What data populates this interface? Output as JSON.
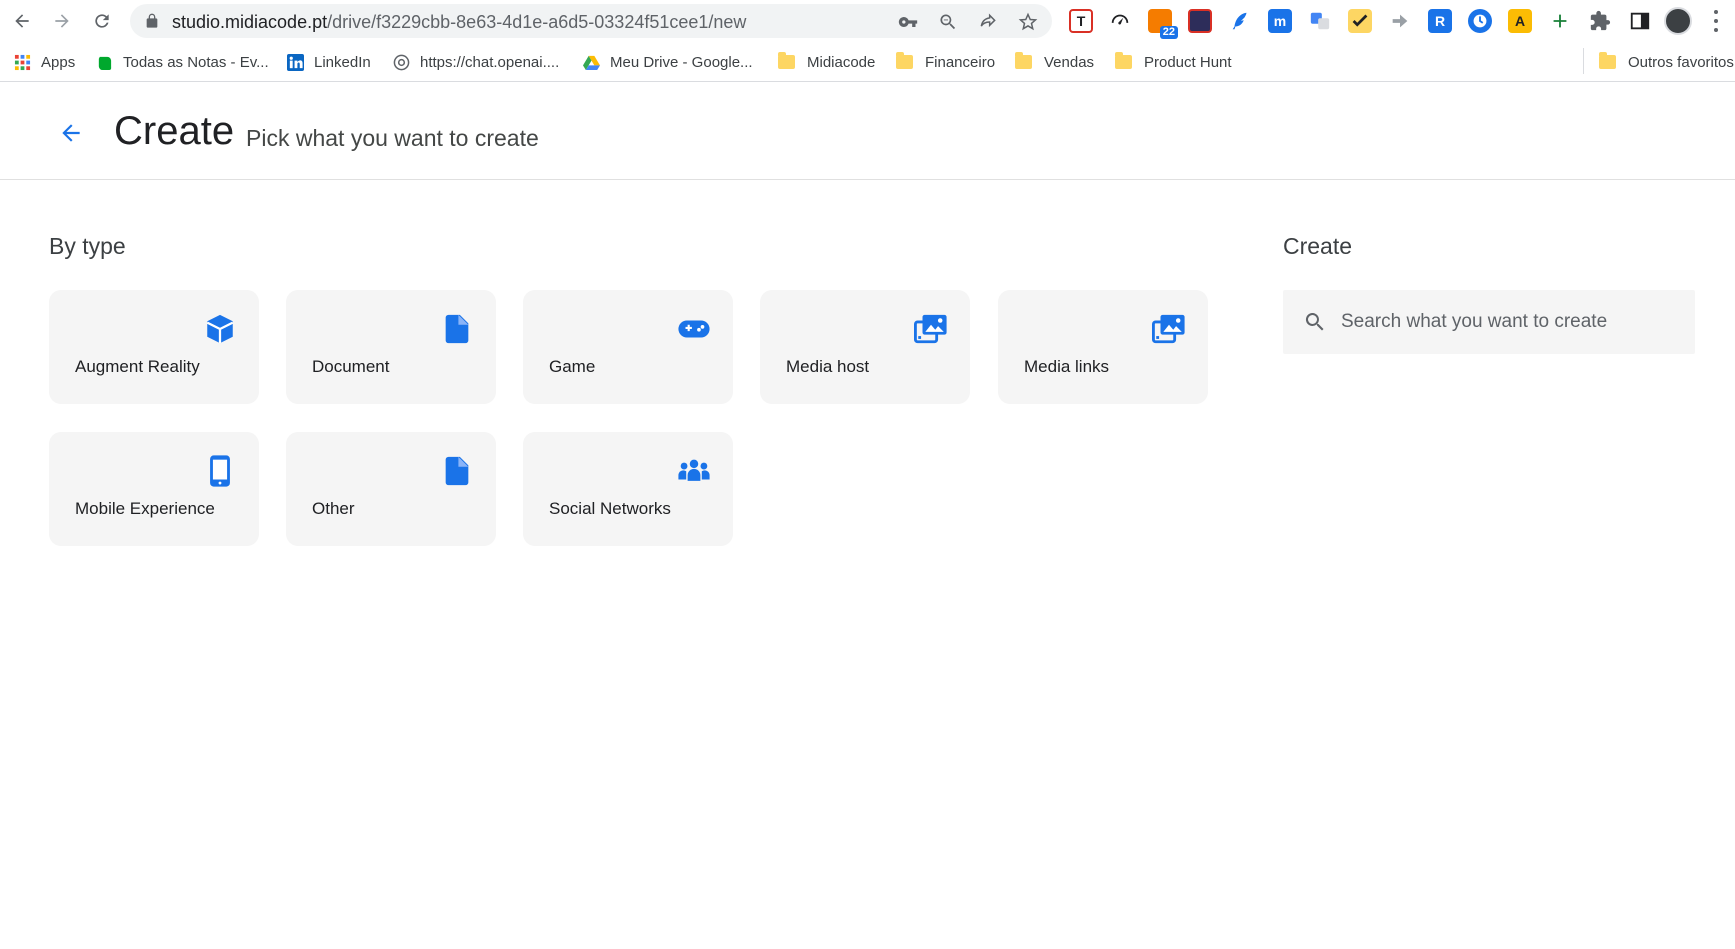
{
  "browser": {
    "url_host": "studio.midiacode.pt",
    "url_path": "/drive/f3229cbb-8e63-4d1e-a6d5-03324f51cee1/new",
    "extension_badge": "22",
    "extensions": [
      "T",
      "m",
      "R",
      "A"
    ]
  },
  "bookmarks": [
    {
      "label": "Apps"
    },
    {
      "label": "Todas as Notas - Ev..."
    },
    {
      "label": "LinkedIn"
    },
    {
      "label": "https://chat.openai...."
    },
    {
      "label": "Meu Drive - Google..."
    },
    {
      "label": "Midiacode"
    },
    {
      "label": "Financeiro"
    },
    {
      "label": "Vendas"
    },
    {
      "label": "Product Hunt"
    },
    {
      "label": "Outros favoritos"
    }
  ],
  "header": {
    "title": "Create",
    "subtitle": "Pick what you want to create"
  },
  "by_type": {
    "title": "By type",
    "items": [
      {
        "label": "Augment Reality",
        "icon": "cube-icon"
      },
      {
        "label": "Document",
        "icon": "document-icon"
      },
      {
        "label": "Game",
        "icon": "gamepad-icon"
      },
      {
        "label": "Media host",
        "icon": "media-library-icon"
      },
      {
        "label": "Media links",
        "icon": "media-library-icon"
      },
      {
        "label": "Mobile Experience",
        "icon": "smartphone-icon"
      },
      {
        "label": "Other",
        "icon": "document-icon"
      },
      {
        "label": "Social Networks",
        "icon": "groups-icon"
      }
    ]
  },
  "create": {
    "title": "Create",
    "search_placeholder": "Search what you want to create"
  },
  "colors": {
    "accent": "#1a73e8",
    "card_background": "#f5f5f5",
    "title_text": "#202124",
    "subtitle_text": "#444746"
  }
}
